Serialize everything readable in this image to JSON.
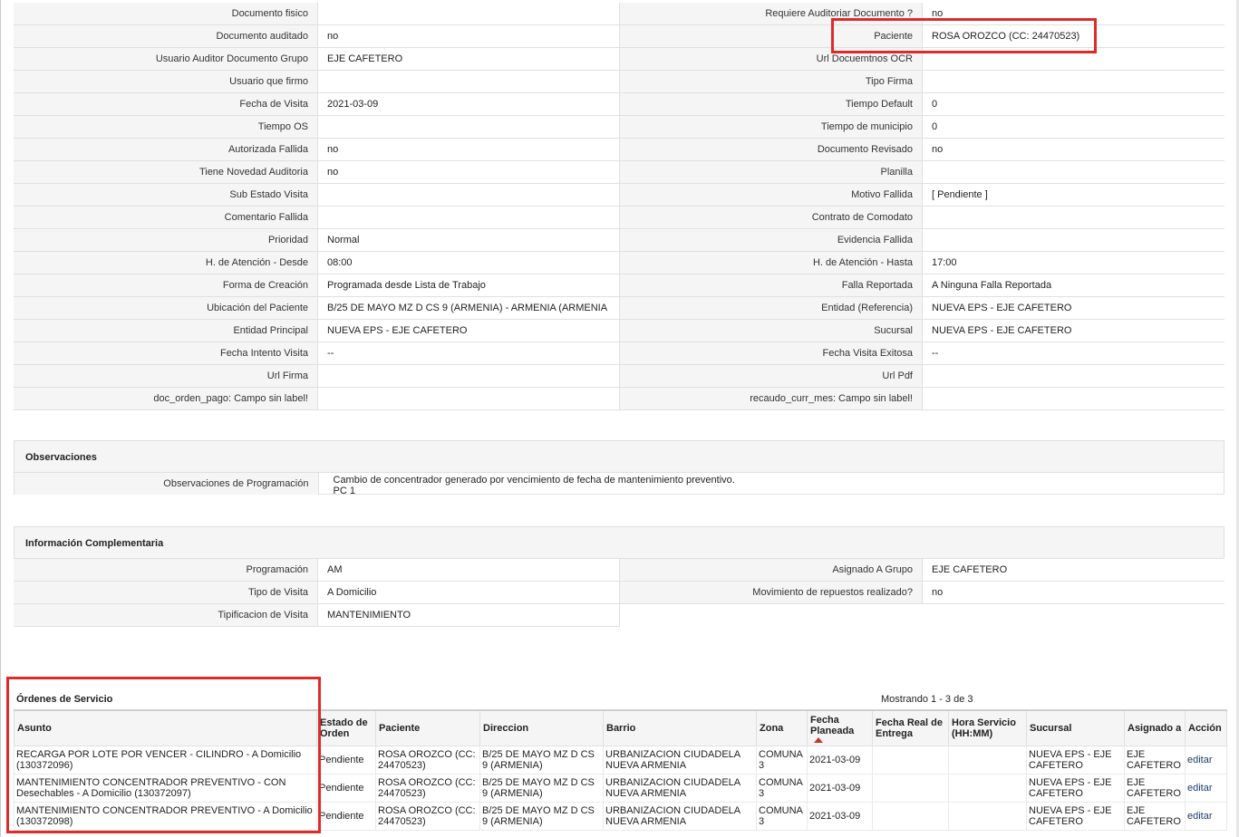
{
  "details": [
    {
      "l1": "Documento fisico",
      "v1": "",
      "l2": "Requiere Auditoriar Documento ?",
      "v2": "no"
    },
    {
      "l1": "Documento auditado",
      "v1": "no",
      "l2": "Paciente",
      "v2": "ROSA OROZCO (CC: 24470523)"
    },
    {
      "l1": "Usuario Auditor Documento Grupo",
      "v1": "EJE CAFETERO",
      "l2": "Url Docuemtnos OCR",
      "v2": ""
    },
    {
      "l1": "Usuario que firmo",
      "v1": "",
      "l2": "Tipo Firma",
      "v2": ""
    },
    {
      "l1": "Fecha de Visita",
      "v1": "2021-03-09",
      "l2": "Tiempo Default",
      "v2": "0"
    },
    {
      "l1": "Tiempo OS",
      "v1": "",
      "l2": "Tiempo de municipio",
      "v2": "0"
    },
    {
      "l1": "Autorizada Fallida",
      "v1": "no",
      "l2": "Documento Revisado",
      "v2": "no"
    },
    {
      "l1": "Tiene Novedad Auditoria",
      "v1": "no",
      "l2": "Planilla",
      "v2": ""
    },
    {
      "l1": "Sub Estado Visita",
      "v1": "",
      "l2": "Motivo Fallida",
      "v2": "[ Pendiente ]"
    },
    {
      "l1": "Comentario Fallida",
      "v1": "",
      "l2": "Contrato de Comodato",
      "v2": ""
    },
    {
      "l1": "Prioridad",
      "v1": "Normal",
      "l2": "Evidencia Fallida",
      "v2": ""
    },
    {
      "l1": "H. de Atención - Desde",
      "v1": "08:00",
      "l2": "H. de Atención - Hasta",
      "v2": "17:00"
    },
    {
      "l1": "Forma de Creación",
      "v1": "Programada desde Lista de Trabajo",
      "l2": "Falla Reportada",
      "v2": "A Ninguna Falla Reportada"
    },
    {
      "l1": "Ubicación del Paciente",
      "v1": "B/25 DE MAYO MZ D CS 9 (ARMENIA) - ARMENIA (ARMENIA",
      "l2": "Entidad (Referencia)",
      "v2": "NUEVA EPS - EJE CAFETERO"
    },
    {
      "l1": "Entidad Principal",
      "v1": "NUEVA EPS - EJE CAFETERO",
      "l2": "Sucursal",
      "v2": "NUEVA EPS - EJE CAFETERO"
    },
    {
      "l1": "Fecha Intento Visita",
      "v1": "--",
      "l2": "Fecha Visita Exitosa",
      "v2": "--"
    },
    {
      "l1": "Url Firma",
      "v1": "",
      "l2": "Url Pdf",
      "v2": ""
    },
    {
      "l1": "doc_orden_pago: Campo sin label!",
      "v1": "",
      "l2": "recaudo_curr_mes: Campo sin label!",
      "v2": ""
    }
  ],
  "observaciones": {
    "title": "Observaciones",
    "label": "Observaciones de Programación",
    "value": "Cambio de concentrador generado por vencimiento de fecha de mantenimiento preventivo.\nPC 1"
  },
  "complementaria": {
    "title": "Información Complementaria",
    "rows": [
      {
        "l1": "Programación",
        "v1": "AM",
        "l2": "Asignado A Grupo",
        "v2": "EJE CAFETERO"
      },
      {
        "l1": "Tipo de Visita",
        "v1": "A Domicilio",
        "l2": "Movimiento de repuestos realizado?",
        "v2": "no"
      }
    ],
    "last": {
      "l1": "Tipificacion de Visita",
      "v1": "MANTENIMIENTO"
    }
  },
  "orders": {
    "title": "Órdenes de Servicio",
    "count": "Mostrando 1 - 3 de 3",
    "headers": [
      "Asunto",
      "Estado de Orden",
      "Paciente",
      "Direccion",
      "Barrio",
      "Zona",
      "Fecha Planeada",
      "Fecha Real de Entrega",
      "Hora Servicio (HH:MM)",
      "Sucursal",
      "Asignado a",
      "Acción"
    ],
    "rows": [
      {
        "asunto": "RECARGA POR LOTE POR VENCER - CILINDRO - A Domicilio (130372096)",
        "estado": "Pendiente",
        "paciente": "ROSA OROZCO (CC: 24470523)",
        "direccion": "B/25 DE MAYO MZ D CS 9 (ARMENIA)",
        "barrio": "URBANIZACION CIUDADELA NUEVA ARMENIA",
        "zona": "COMUNA 3",
        "fecha": "2021-03-09",
        "real": "",
        "hora": "",
        "sucursal": "NUEVA EPS - EJE CAFETERO",
        "asignado": "EJE CAFETERO",
        "accion": "editar"
      },
      {
        "asunto": "MANTENIMIENTO CONCENTRADOR PREVENTIVO - CON Desechables - A Domicilio (130372097)",
        "estado": "Pendiente",
        "paciente": "ROSA OROZCO (CC: 24470523)",
        "direccion": "B/25 DE MAYO MZ D CS 9 (ARMENIA)",
        "barrio": "URBANIZACION CIUDADELA NUEVA ARMENIA",
        "zona": "COMUNA 3",
        "fecha": "2021-03-09",
        "real": "",
        "hora": "",
        "sucursal": "NUEVA EPS - EJE CAFETERO",
        "asignado": "EJE CAFETERO",
        "accion": "editar"
      },
      {
        "asunto": "MANTENIMIENTO CONCENTRADOR PREVENTIVO - A Domicilio (130372098)",
        "estado": "Pendiente",
        "paciente": "ROSA OROZCO (CC: 24470523)",
        "direccion": "B/25 DE MAYO MZ D CS 9 (ARMENIA)",
        "barrio": "URBANIZACION CIUDADELA NUEVA ARMENIA",
        "zona": "COMUNA 3",
        "fecha": "2021-03-09",
        "real": "",
        "hora": "",
        "sucursal": "NUEVA EPS - EJE CAFETERO",
        "asignado": "EJE CAFETERO",
        "accion": "editar"
      }
    ]
  },
  "colors": {
    "highlight": "#e02a2a",
    "sort_arrow": "#c0392b",
    "label_bg": "#f5f5f5"
  }
}
